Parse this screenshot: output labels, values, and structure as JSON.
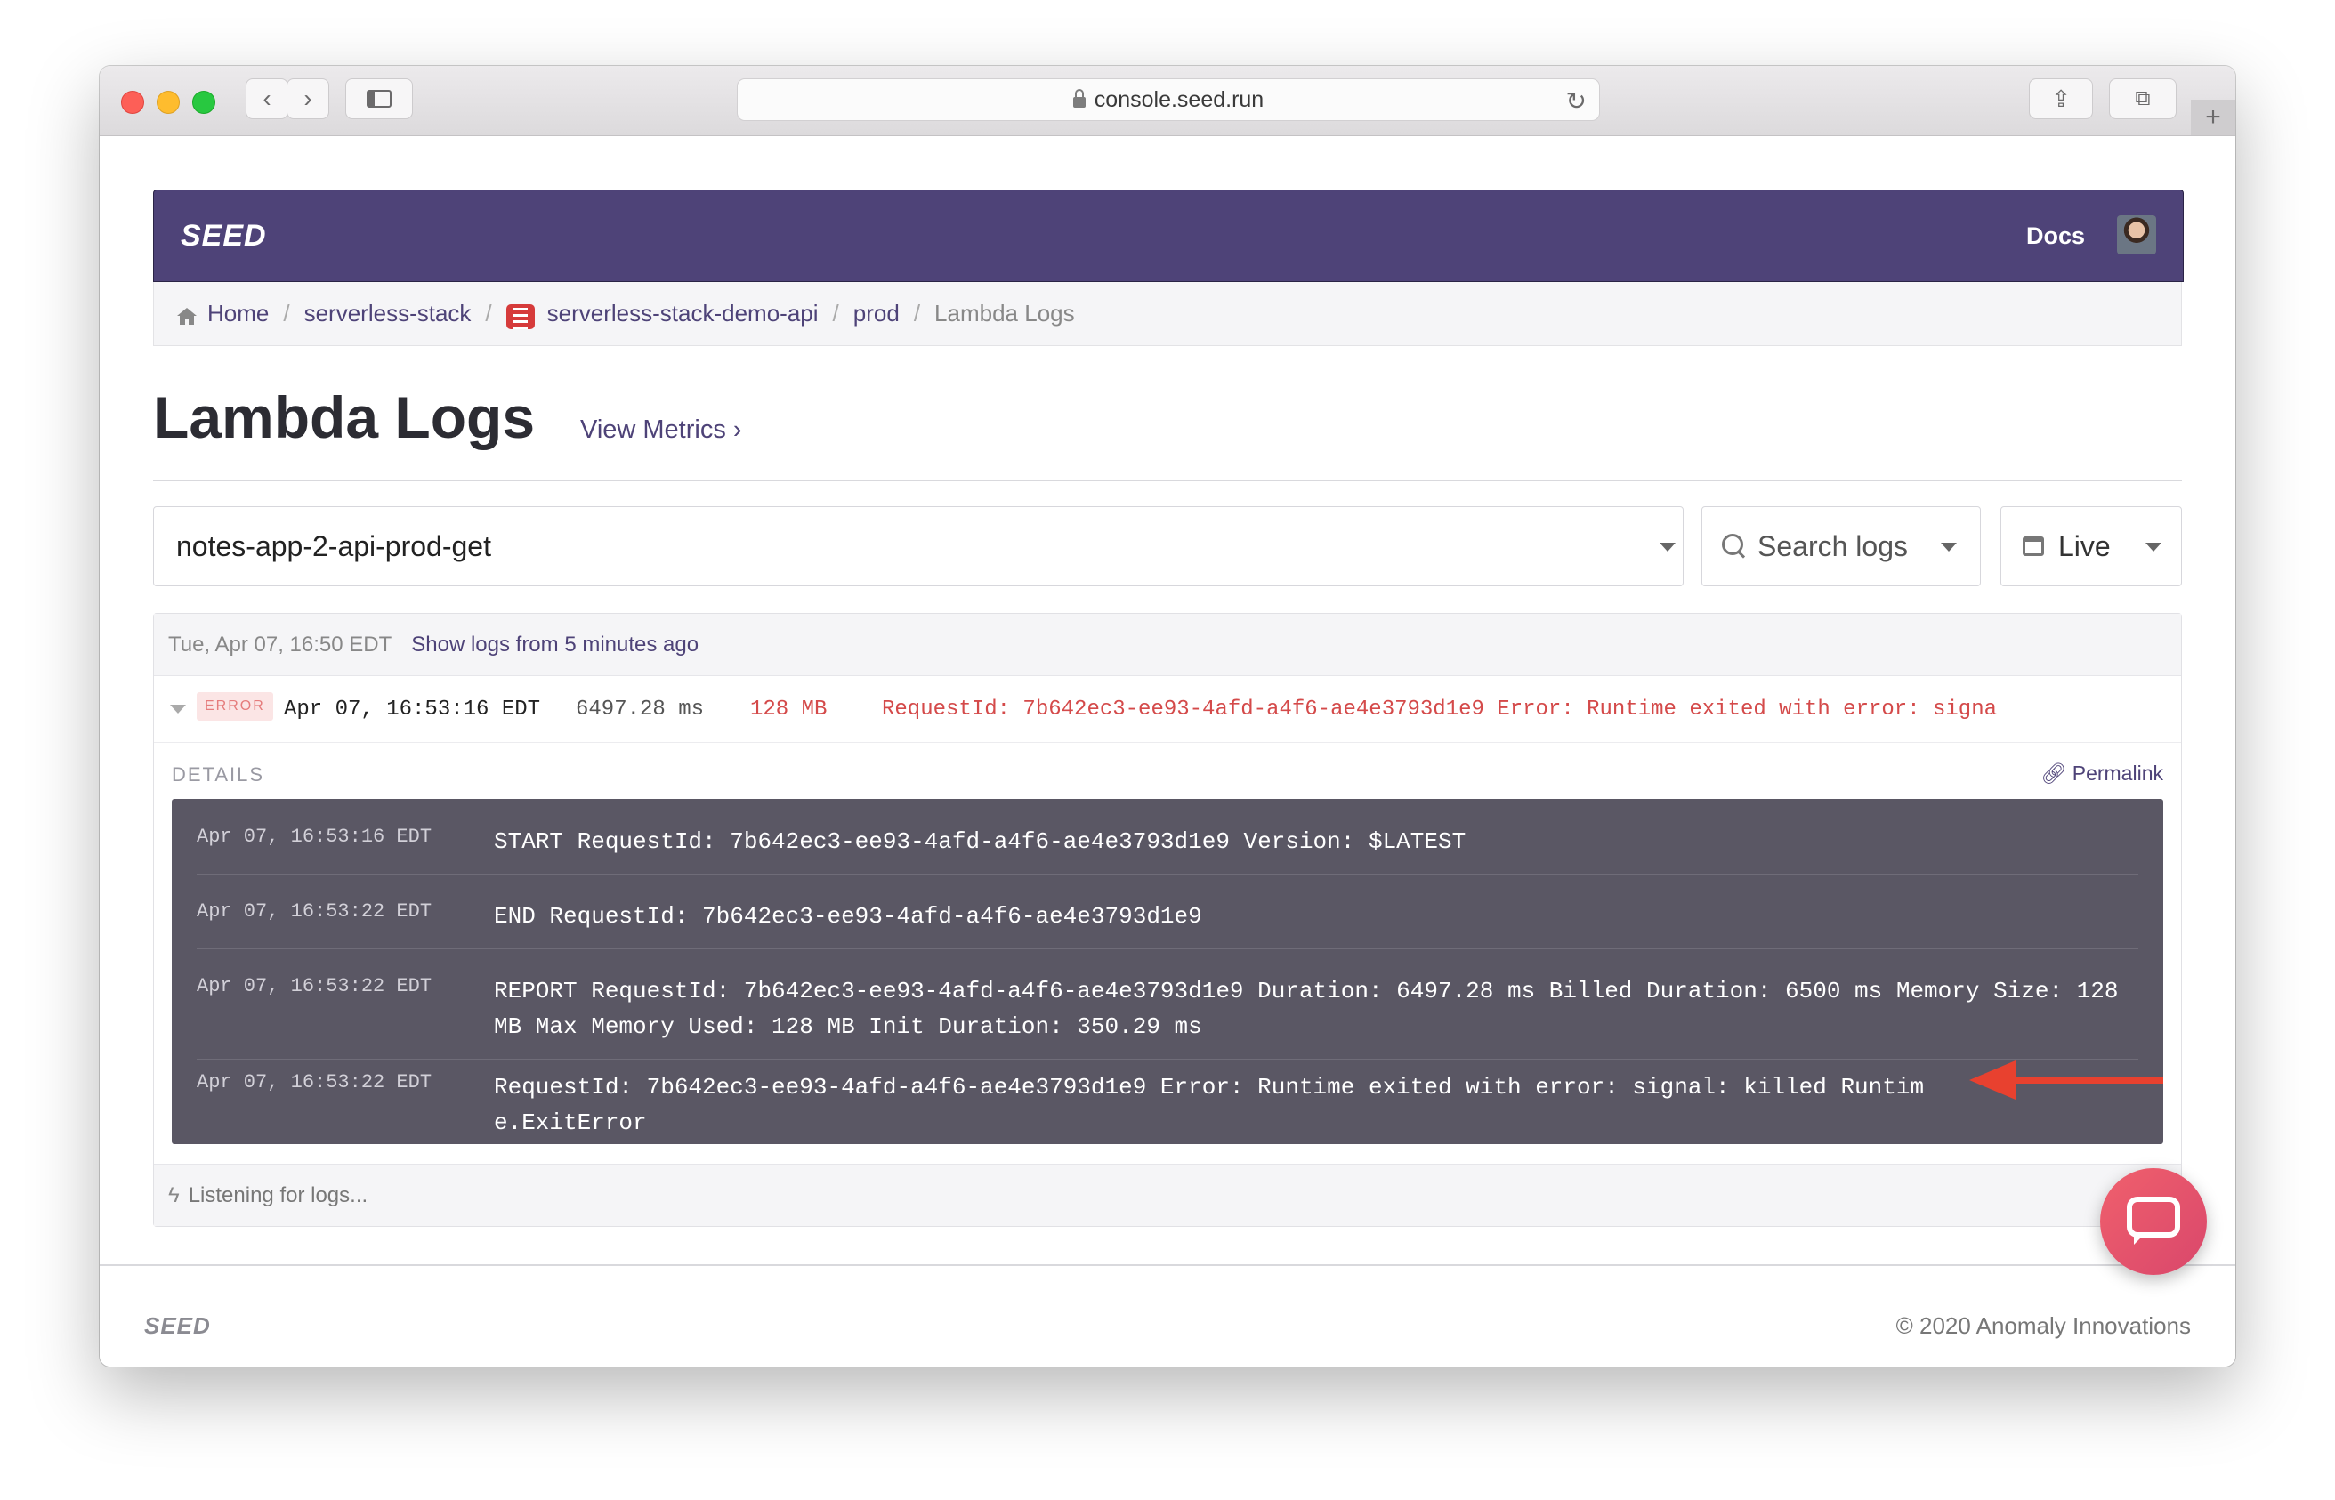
{
  "browser": {
    "url": "console.seed.run"
  },
  "navbar": {
    "logo": "SEED",
    "docs_label": "Docs"
  },
  "breadcrumb": {
    "home": "Home",
    "org": "serverless-stack",
    "app": "serverless-stack-demo-api",
    "stage": "prod",
    "current": "Lambda Logs"
  },
  "page": {
    "title": "Lambda Logs",
    "view_metrics": "View Metrics ›"
  },
  "filters": {
    "function_value": "notes-app-2-api-prod-get",
    "search_placeholder": "Search logs",
    "time_value": "Live"
  },
  "logs": {
    "header_timestamp": "Tue, Apr 07, 16:50 EDT",
    "show_earlier": "Show logs from 5 minutes ago",
    "entry": {
      "level": "ERROR",
      "timestamp": "Apr 07, 16:53:16 EDT",
      "duration": "6497.28 ms",
      "memory": "128 MB",
      "message": "RequestId: 7b642ec3-ee93-4afd-a4f6-ae4e3793d1e9 Error: Runtime exited with error: signa"
    },
    "details_label": "DETAILS",
    "permalink": "Permalink",
    "lines": [
      {
        "ts": "Apr 07, 16:53:16 EDT",
        "msg": "START RequestId: 7b642ec3-ee93-4afd-a4f6-ae4e3793d1e9 Version: $LATEST"
      },
      {
        "ts": "Apr 07, 16:53:22 EDT",
        "msg": "END RequestId: 7b642ec3-ee93-4afd-a4f6-ae4e3793d1e9"
      },
      {
        "ts": "Apr 07, 16:53:22 EDT",
        "msg": "REPORT RequestId: 7b642ec3-ee93-4afd-a4f6-ae4e3793d1e9 Duration: 6497.28 ms Billed Duration: 6500 ms Memory Size: 128 MB Max Memory Used: 128 MB Init Duration: 350.29 ms"
      },
      {
        "ts": "Apr 07, 16:53:22 EDT",
        "msg": "RequestId: 7b642ec3-ee93-4afd-a4f6-ae4e3793d1e9 Error: Runtime exited with error: signal: killed Runtime.ExitError"
      }
    ],
    "listening": "Listening for logs..."
  },
  "footer": {
    "logo": "SEED",
    "copyright": "© 2020 Anomaly Innovations"
  },
  "colors": {
    "brand": "#4e4378",
    "error": "#d44a4a",
    "console_bg": "#5a5764",
    "annotation_arrow": "#e8412f"
  }
}
